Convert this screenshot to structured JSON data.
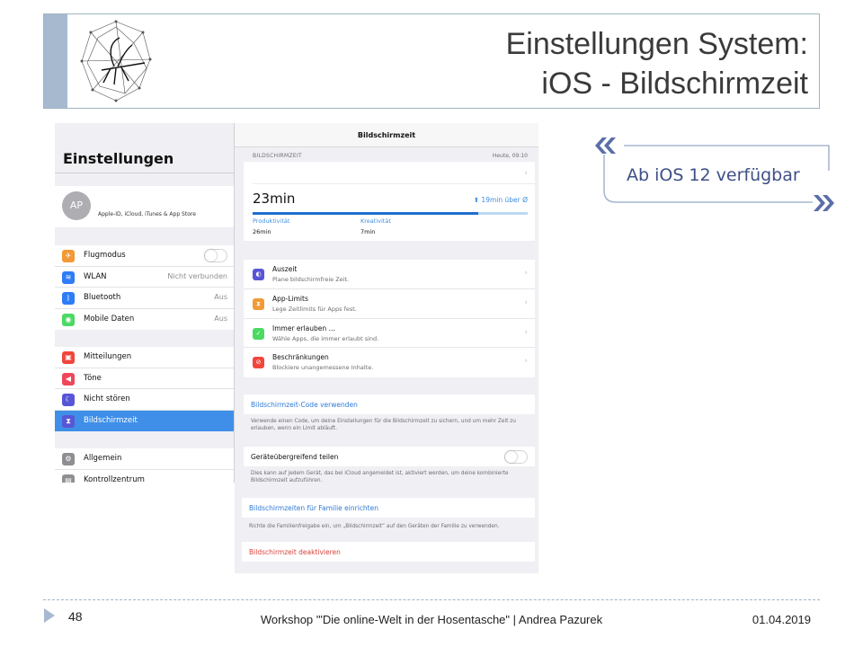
{
  "slide": {
    "title_line1": "Einstellungen System:",
    "title_line2": "iOS - Bildschirmzeit",
    "accent_color": "#a7b9cf"
  },
  "settings": {
    "heading": "Einstellungen",
    "account": {
      "initials": "AP",
      "subtitle": "Apple-ID, iCloud, iTunes & App Store"
    },
    "group1": [
      {
        "label": "Flugmodus",
        "value": "",
        "toggle": true,
        "icon": "airplane-icon",
        "color": "#f19a37",
        "glyph": "✈"
      },
      {
        "label": "WLAN",
        "value": "Nicht verbunden",
        "icon": "wifi-icon",
        "color": "#2e7cf6",
        "glyph": "≋"
      },
      {
        "label": "Bluetooth",
        "value": "Aus",
        "icon": "bluetooth-icon",
        "color": "#2e7cf6",
        "glyph": "ᛒ"
      },
      {
        "label": "Mobile Daten",
        "value": "Aus",
        "icon": "antenna-icon",
        "color": "#4cd964",
        "glyph": "◉"
      }
    ],
    "group2": [
      {
        "label": "Mitteilungen",
        "icon": "notifications-icon",
        "color": "#f0463c",
        "glyph": "▣"
      },
      {
        "label": "Töne",
        "icon": "speaker-icon",
        "color": "#f0465a",
        "glyph": "◀"
      },
      {
        "label": "Nicht stören",
        "icon": "moon-icon",
        "color": "#5856d6",
        "glyph": "☾"
      },
      {
        "label": "Bildschirmzeit",
        "icon": "hourglass-icon",
        "color": "#5856d6",
        "glyph": "⧗",
        "selected": true
      }
    ],
    "group3": [
      {
        "label": "Allgemein",
        "icon": "gear-icon",
        "color": "#8e8e93",
        "glyph": "⚙"
      },
      {
        "label": "Kontrollzentrum",
        "icon": "control-center-icon",
        "color": "#8e8e93",
        "glyph": "▤"
      }
    ]
  },
  "screentime": {
    "nav_title": "Bildschirmzeit",
    "caption": "BILDSCHIRMZEIT",
    "date": "Heute, 09:10",
    "total": "23min",
    "average": "19min über Ø",
    "bar_fraction": 0.82,
    "categories": [
      {
        "name": "Produktivität",
        "value": "26min"
      },
      {
        "name": "Kreativität",
        "value": "7min"
      }
    ],
    "items": [
      {
        "title": "Auszeit",
        "subtitle": "Plane bildschirmfreie Zeit.",
        "icon": "downtime-icon",
        "color": "#5856d6",
        "glyph": "◐"
      },
      {
        "title": "App-Limits",
        "subtitle": "Lege Zeitlimits für Apps fest.",
        "icon": "hourglass-icon",
        "color": "#f19a37",
        "glyph": "⧗"
      },
      {
        "title": "Immer erlauben …",
        "subtitle": "Wähle Apps, die immer erlaubt sind.",
        "icon": "checkmark-icon",
        "color": "#4cd964",
        "glyph": "✓"
      },
      {
        "title": "Beschränkungen",
        "subtitle": "Blockiere unangemessene Inhalte.",
        "icon": "restriction-icon",
        "color": "#f0463c",
        "glyph": "⊘"
      }
    ],
    "code_link": "Bildschirmzeit-Code verwenden",
    "code_note": "Verwende einen Code, um deine Einstellungen für die Bildschirmzeit zu sichern, und um mehr Zeit zu erlauben, wenn ein Limit abläuft.",
    "share_label": "Geräteübergreifend teilen",
    "share_note": "Dies kann auf jedem Gerät, das bei iCloud angemeldet ist, aktiviert werden, um deine kombinierte Bildschirmzeit aufzuführen.",
    "family_link": "Bildschirmzeiten für Familie einrichten",
    "family_note": "Richte die Familienfreigabe ein, um „Bildschirmzeit“ auf den Geräten der Familie zu verwenden.",
    "deactivate": "Bildschirmzeit deaktivieren"
  },
  "callout": {
    "text": "Ab iOS 12 verfügbar",
    "color": "#3e4f86"
  },
  "footer": {
    "page_number": "48",
    "text": "Workshop '\"Die online-Welt  in der Hosentasche\" | Andrea Pazurek",
    "date": "01.04.2019"
  }
}
